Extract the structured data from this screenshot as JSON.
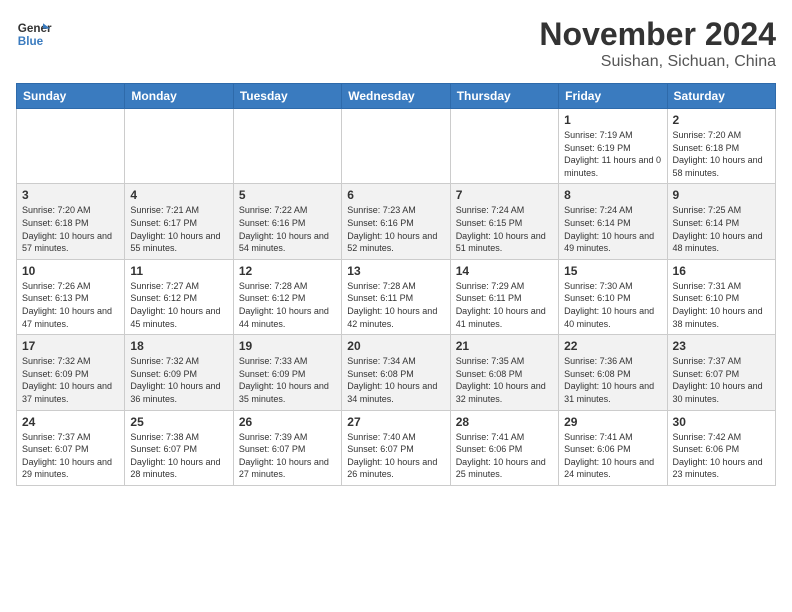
{
  "header": {
    "logo_line1": "General",
    "logo_line2": "Blue",
    "title": "November 2024",
    "subtitle": "Suishan, Sichuan, China"
  },
  "days_of_week": [
    "Sunday",
    "Monday",
    "Tuesday",
    "Wednesday",
    "Thursday",
    "Friday",
    "Saturday"
  ],
  "weeks": [
    [
      {
        "day": "",
        "info": ""
      },
      {
        "day": "",
        "info": ""
      },
      {
        "day": "",
        "info": ""
      },
      {
        "day": "",
        "info": ""
      },
      {
        "day": "",
        "info": ""
      },
      {
        "day": "1",
        "info": "Sunrise: 7:19 AM\nSunset: 6:19 PM\nDaylight: 11 hours and 0 minutes."
      },
      {
        "day": "2",
        "info": "Sunrise: 7:20 AM\nSunset: 6:18 PM\nDaylight: 10 hours and 58 minutes."
      }
    ],
    [
      {
        "day": "3",
        "info": "Sunrise: 7:20 AM\nSunset: 6:18 PM\nDaylight: 10 hours and 57 minutes."
      },
      {
        "day": "4",
        "info": "Sunrise: 7:21 AM\nSunset: 6:17 PM\nDaylight: 10 hours and 55 minutes."
      },
      {
        "day": "5",
        "info": "Sunrise: 7:22 AM\nSunset: 6:16 PM\nDaylight: 10 hours and 54 minutes."
      },
      {
        "day": "6",
        "info": "Sunrise: 7:23 AM\nSunset: 6:16 PM\nDaylight: 10 hours and 52 minutes."
      },
      {
        "day": "7",
        "info": "Sunrise: 7:24 AM\nSunset: 6:15 PM\nDaylight: 10 hours and 51 minutes."
      },
      {
        "day": "8",
        "info": "Sunrise: 7:24 AM\nSunset: 6:14 PM\nDaylight: 10 hours and 49 minutes."
      },
      {
        "day": "9",
        "info": "Sunrise: 7:25 AM\nSunset: 6:14 PM\nDaylight: 10 hours and 48 minutes."
      }
    ],
    [
      {
        "day": "10",
        "info": "Sunrise: 7:26 AM\nSunset: 6:13 PM\nDaylight: 10 hours and 47 minutes."
      },
      {
        "day": "11",
        "info": "Sunrise: 7:27 AM\nSunset: 6:12 PM\nDaylight: 10 hours and 45 minutes."
      },
      {
        "day": "12",
        "info": "Sunrise: 7:28 AM\nSunset: 6:12 PM\nDaylight: 10 hours and 44 minutes."
      },
      {
        "day": "13",
        "info": "Sunrise: 7:28 AM\nSunset: 6:11 PM\nDaylight: 10 hours and 42 minutes."
      },
      {
        "day": "14",
        "info": "Sunrise: 7:29 AM\nSunset: 6:11 PM\nDaylight: 10 hours and 41 minutes."
      },
      {
        "day": "15",
        "info": "Sunrise: 7:30 AM\nSunset: 6:10 PM\nDaylight: 10 hours and 40 minutes."
      },
      {
        "day": "16",
        "info": "Sunrise: 7:31 AM\nSunset: 6:10 PM\nDaylight: 10 hours and 38 minutes."
      }
    ],
    [
      {
        "day": "17",
        "info": "Sunrise: 7:32 AM\nSunset: 6:09 PM\nDaylight: 10 hours and 37 minutes."
      },
      {
        "day": "18",
        "info": "Sunrise: 7:32 AM\nSunset: 6:09 PM\nDaylight: 10 hours and 36 minutes."
      },
      {
        "day": "19",
        "info": "Sunrise: 7:33 AM\nSunset: 6:09 PM\nDaylight: 10 hours and 35 minutes."
      },
      {
        "day": "20",
        "info": "Sunrise: 7:34 AM\nSunset: 6:08 PM\nDaylight: 10 hours and 34 minutes."
      },
      {
        "day": "21",
        "info": "Sunrise: 7:35 AM\nSunset: 6:08 PM\nDaylight: 10 hours and 32 minutes."
      },
      {
        "day": "22",
        "info": "Sunrise: 7:36 AM\nSunset: 6:08 PM\nDaylight: 10 hours and 31 minutes."
      },
      {
        "day": "23",
        "info": "Sunrise: 7:37 AM\nSunset: 6:07 PM\nDaylight: 10 hours and 30 minutes."
      }
    ],
    [
      {
        "day": "24",
        "info": "Sunrise: 7:37 AM\nSunset: 6:07 PM\nDaylight: 10 hours and 29 minutes."
      },
      {
        "day": "25",
        "info": "Sunrise: 7:38 AM\nSunset: 6:07 PM\nDaylight: 10 hours and 28 minutes."
      },
      {
        "day": "26",
        "info": "Sunrise: 7:39 AM\nSunset: 6:07 PM\nDaylight: 10 hours and 27 minutes."
      },
      {
        "day": "27",
        "info": "Sunrise: 7:40 AM\nSunset: 6:07 PM\nDaylight: 10 hours and 26 minutes."
      },
      {
        "day": "28",
        "info": "Sunrise: 7:41 AM\nSunset: 6:06 PM\nDaylight: 10 hours and 25 minutes."
      },
      {
        "day": "29",
        "info": "Sunrise: 7:41 AM\nSunset: 6:06 PM\nDaylight: 10 hours and 24 minutes."
      },
      {
        "day": "30",
        "info": "Sunrise: 7:42 AM\nSunset: 6:06 PM\nDaylight: 10 hours and 23 minutes."
      }
    ]
  ]
}
